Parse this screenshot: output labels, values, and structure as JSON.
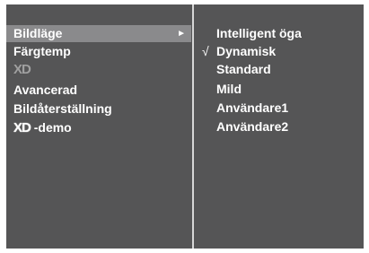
{
  "menu": {
    "items": [
      {
        "label": "Bildläge",
        "arrow": "►"
      },
      {
        "label": "Färgtemp"
      },
      {
        "logo": "XD"
      },
      {
        "label": "Avancerad"
      },
      {
        "label": "Bildåterställning"
      },
      {
        "logo": "XD",
        "label": "-demo"
      }
    ]
  },
  "submenu": {
    "check_mark": "√",
    "options": [
      {
        "label": "Intelligent öga"
      },
      {
        "label": "Dynamisk",
        "checked": true
      },
      {
        "label": "Standard"
      },
      {
        "label": "Mild"
      },
      {
        "label": "Användare1"
      },
      {
        "label": "Användare2"
      }
    ]
  },
  "colors": {
    "panel_bg": "#555556",
    "highlight_bg": "#8a8a8c",
    "divider": "#d7d7d7",
    "text": "#ffffff",
    "logo_dim": "#a0a0a0"
  }
}
